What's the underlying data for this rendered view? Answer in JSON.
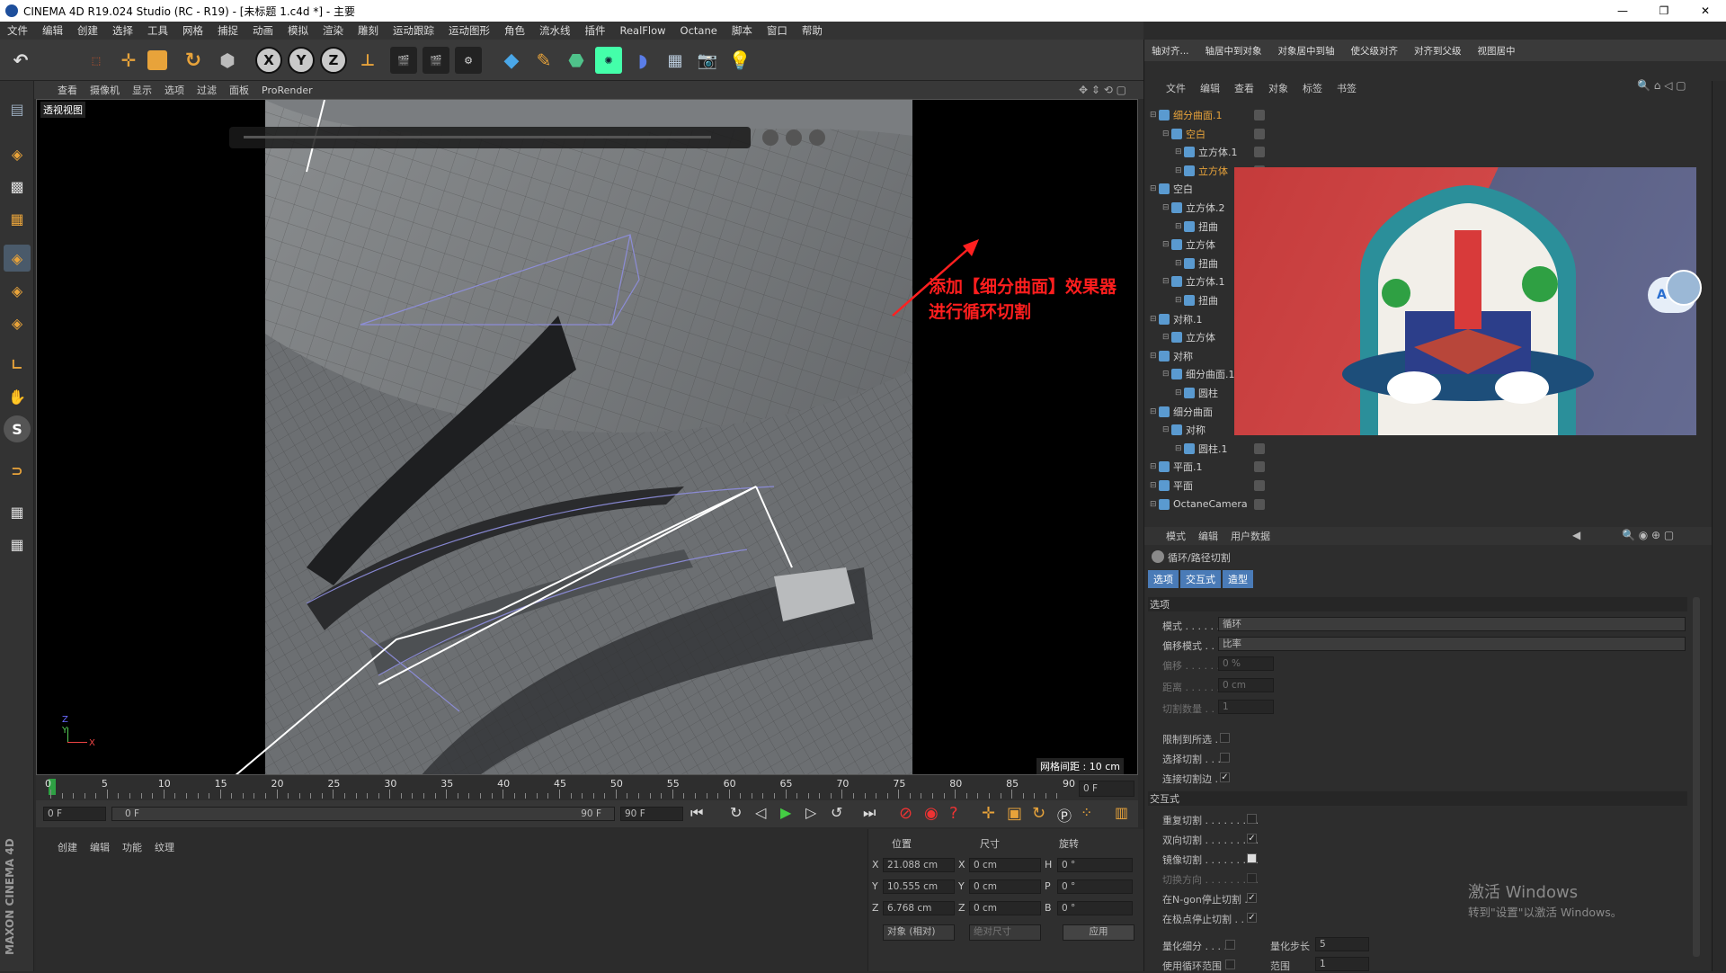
{
  "window": {
    "title": "CINEMA 4D R19.024 Studio (RC - R19) - [未标题 1.c4d *] - 主要"
  },
  "menu": [
    "文件",
    "编辑",
    "创建",
    "选择",
    "工具",
    "网格",
    "捕捉",
    "动画",
    "模拟",
    "渲染",
    "雕刻",
    "运动跟踪",
    "运动图形",
    "角色",
    "流水线",
    "插件",
    "RealFlow",
    "Octane",
    "脚本",
    "窗口",
    "帮助"
  ],
  "toolbar": {
    "x_label": "X",
    "y_label": "Y",
    "z_label": "Z"
  },
  "viewport_menu": [
    "查看",
    "摄像机",
    "显示",
    "选项",
    "过滤",
    "面板",
    "ProRender"
  ],
  "viewport": {
    "label": "透视视图",
    "grid_spacing": "网格间距 : 10 cm",
    "annotation_line1": "添加【细分曲面】效果器",
    "annotation_line2": "进行循环切割",
    "axis_z": "Z",
    "axis_x": "X",
    "axis_y": "Y"
  },
  "timeline": {
    "ticks": [
      "0",
      "5",
      "10",
      "15",
      "20",
      "25",
      "30",
      "35",
      "40",
      "45",
      "50",
      "55",
      "60",
      "65",
      "70",
      "75",
      "80",
      "85",
      "90"
    ],
    "end_field": "0 F",
    "start_field": "0 F",
    "range_start": "0 F",
    "range_end": "90 F",
    "max_field": "90 F"
  },
  "lower_tabs": [
    "创建",
    "编辑",
    "功能",
    "纹理"
  ],
  "coords": {
    "headers": [
      "位置",
      "尺寸",
      "旋转"
    ],
    "rows": [
      {
        "axis": "X",
        "pos": "21.088 cm",
        "size_axis": "X",
        "size": "0 cm",
        "rot_axis": "H",
        "rot": "0 °"
      },
      {
        "axis": "Y",
        "pos": "10.555 cm",
        "size_axis": "Y",
        "size": "0 cm",
        "rot_axis": "P",
        "rot": "0 °"
      },
      {
        "axis": "Z",
        "pos": "6.768 cm",
        "size_axis": "Z",
        "size": "0 cm",
        "rot_axis": "B",
        "rot": "0 °"
      }
    ],
    "mode": "对象 (相对)",
    "size_mode": "绝对尺寸",
    "apply": "应用"
  },
  "right_toolbar": [
    "轴对齐...",
    "轴居中到对象",
    "对象居中到轴",
    "使父级对齐",
    "对齐到父级",
    "视图居中"
  ],
  "object_menu": [
    "文件",
    "编辑",
    "查看",
    "对象",
    "标签",
    "书签"
  ],
  "objects": [
    {
      "name": "细分曲面.1",
      "indent": 0,
      "color": "#e8a33a"
    },
    {
      "name": "空白",
      "indent": 1,
      "color": "#e8a33a"
    },
    {
      "name": "立方体.1",
      "indent": 2,
      "color": "#cfcfcf"
    },
    {
      "name": "立方体",
      "indent": 2,
      "color": "#e8a33a"
    },
    {
      "name": "空白",
      "indent": 0,
      "color": "#cfcfcf"
    },
    {
      "name": "立方体.2",
      "indent": 1,
      "color": "#cfcfcf"
    },
    {
      "name": "扭曲",
      "indent": 2,
      "color": "#cfcfcf"
    },
    {
      "name": "立方体",
      "indent": 1,
      "color": "#cfcfcf"
    },
    {
      "name": "扭曲",
      "indent": 2,
      "color": "#cfcfcf"
    },
    {
      "name": "立方体.1",
      "indent": 1,
      "color": "#cfcfcf"
    },
    {
      "name": "扭曲",
      "indent": 2,
      "color": "#cfcfcf"
    },
    {
      "name": "对称.1",
      "indent": 0,
      "color": "#cfcfcf"
    },
    {
      "name": "立方体",
      "indent": 1,
      "color": "#cfcfcf"
    },
    {
      "name": "对称",
      "indent": 0,
      "color": "#cfcfcf"
    },
    {
      "name": "细分曲面.1",
      "indent": 1,
      "color": "#cfcfcf"
    },
    {
      "name": "圆柱",
      "indent": 2,
      "color": "#cfcfcf"
    },
    {
      "name": "细分曲面",
      "indent": 0,
      "color": "#cfcfcf"
    },
    {
      "name": "对称",
      "indent": 1,
      "color": "#cfcfcf"
    },
    {
      "name": "圆柱.1",
      "indent": 2,
      "color": "#cfcfcf"
    },
    {
      "name": "平面.1",
      "indent": 0,
      "color": "#cfcfcf"
    },
    {
      "name": "平面",
      "indent": 0,
      "color": "#cfcfcf"
    },
    {
      "name": "OctaneCamera",
      "indent": 0,
      "color": "#cfcfcf"
    }
  ],
  "preview_avatar_letter": "A",
  "attr_menu": [
    "模式",
    "编辑",
    "用户数据"
  ],
  "attr": {
    "title": "循环/路径切割",
    "tabs": [
      "选项",
      "交互式",
      "造型"
    ],
    "section_options": "选项",
    "mode_label": "模式 . . . . . .",
    "mode_value": "循环",
    "offset_mode_label": "偏移模式 . .",
    "offset_mode_value": "比率",
    "offset_label": "偏移 . . . . . .",
    "offset_value": "0 %",
    "distance_label": "距离 . . . . . .",
    "distance_value": "0 cm",
    "cuts_label": "切割数量 . . .",
    "cuts_value": "1",
    "limit_label": "限制到所选 . .",
    "select_cut_label": "选择切割 . . . .",
    "connect_label": "连接切割边 . .",
    "section_interactive": "交互式",
    "repeat_label": "重复切割 . . . . . . . . .",
    "bidirectional_label": "双向切割 . . . . . . . . .",
    "mirror_label": "镜像切割 . . . . . . . . .",
    "direction_label": "切换方向 . . . . . . . . .",
    "ngon_label": "在N-gon停止切割 .",
    "pole_label": "在极点停止切割 . .",
    "quantize_label": "量化细分 . . . . .",
    "quantize_step_label": "量化步长",
    "quantize_step_value": "5",
    "loop_range_label": "使用循环范围 . .",
    "range_label": "范围",
    "range_value": "1"
  },
  "watermark": {
    "line1": "激活 Windows",
    "line2": "转到\"设置\"以激活 Windows。"
  },
  "brand": "MAXON CINEMA 4D"
}
